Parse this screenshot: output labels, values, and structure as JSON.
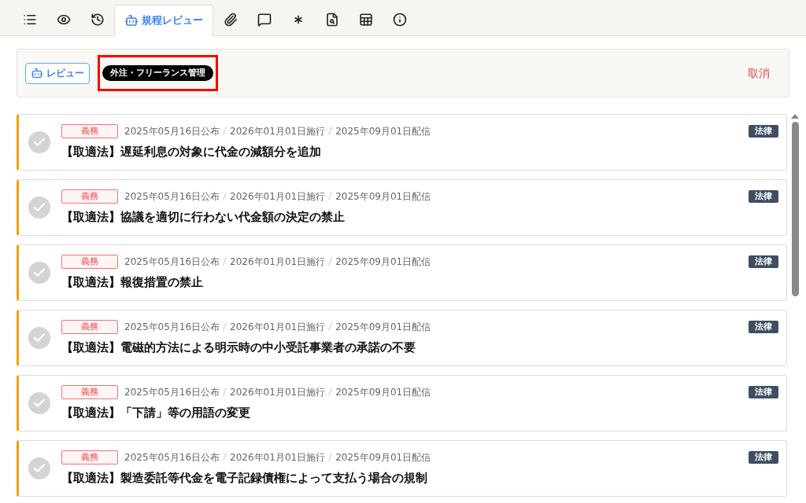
{
  "tabs": [
    {
      "selected": false
    },
    {
      "selected": false
    },
    {
      "selected": false
    },
    {
      "selected": true,
      "label": "規程レビュー"
    },
    {
      "selected": false
    },
    {
      "selected": false
    },
    {
      "selected": false
    },
    {
      "selected": false
    },
    {
      "selected": false
    },
    {
      "selected": false
    }
  ],
  "toolbar": {
    "review_button": "レビュー",
    "tag": "外注・フリーランス管理",
    "tag_highlighted": true,
    "cancel": "取消"
  },
  "items": [
    {
      "checked": false,
      "badge": "義務",
      "published": "2025年05月16日公布",
      "effective": "2026年01月01日施行",
      "delivered": "2025年09月01日配信",
      "type": "法律",
      "title": "【取適法】遅延利息の対象に代金の減額分を追加"
    },
    {
      "checked": false,
      "badge": "義務",
      "published": "2025年05月16日公布",
      "effective": "2026年01月01日施行",
      "delivered": "2025年09月01日配信",
      "type": "法律",
      "title": "【取適法】協議を適切に行わない代金額の決定の禁止"
    },
    {
      "checked": false,
      "badge": "義務",
      "published": "2025年05月16日公布",
      "effective": "2026年01月01日施行",
      "delivered": "2025年09月01日配信",
      "type": "法律",
      "title": "【取適法】報復措置の禁止"
    },
    {
      "checked": false,
      "badge": "義務",
      "published": "2025年05月16日公布",
      "effective": "2026年01月01日施行",
      "delivered": "2025年09月01日配信",
      "type": "法律",
      "title": "【取適法】電磁的方法による明示時の中小受託事業者の承諾の不要"
    },
    {
      "checked": false,
      "badge": "義務",
      "published": "2025年05月16日公布",
      "effective": "2026年01月01日施行",
      "delivered": "2025年09月01日配信",
      "type": "法律",
      "title": "【取適法】「下請」等の用語の変更"
    },
    {
      "checked": false,
      "badge": "義務",
      "published": "2025年05月16日公布",
      "effective": "2026年01月01日施行",
      "delivered": "2025年09月01日配信",
      "type": "法律",
      "title": "【取適法】製造委託等代金を電子記録債権によって支払う場合の規制"
    }
  ]
}
